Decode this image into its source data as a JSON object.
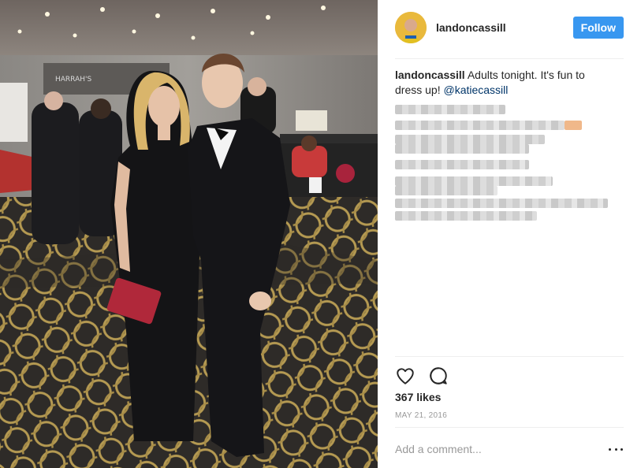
{
  "post": {
    "username": "landoncassill",
    "follow_label": "Follow",
    "caption": {
      "username": "landoncassill",
      "text": "Adults tonight. It's fun to dress up!",
      "mention": "@katiecassill"
    },
    "likes": "367 likes",
    "date": "MAY 21, 2016",
    "comment_placeholder": "Add a comment..."
  },
  "icons": {
    "like": "heart-icon",
    "comment": "comment-bubble-icon",
    "more": "more-options-icon"
  },
  "colors": {
    "accent": "#3897f0",
    "mention": "#003569",
    "muted": "#999999",
    "text": "#262626"
  }
}
